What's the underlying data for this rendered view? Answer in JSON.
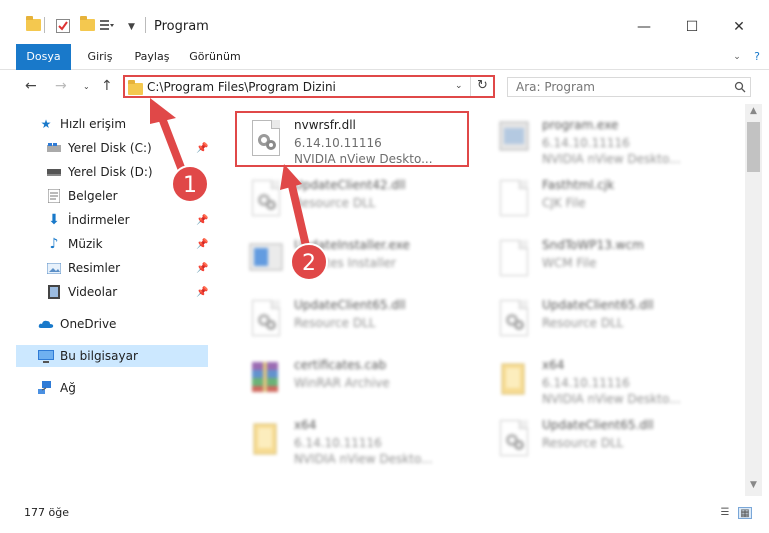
{
  "window": {
    "title": "Program",
    "minimize": "—",
    "maximize": "☐",
    "close": "✕"
  },
  "ribbon": {
    "tabs": [
      {
        "label": "Dosya"
      },
      {
        "label": "Giriş"
      },
      {
        "label": "Paylaş"
      },
      {
        "label": "Görünüm"
      }
    ]
  },
  "nav": {
    "address": "C:\\Program Files\\Program Dizini",
    "search_placeholder": "Ara: Program"
  },
  "sidebar": {
    "items": [
      {
        "label": "Hızlı erişim",
        "icon": "star-icon",
        "pinned": false
      },
      {
        "label": "Yerel Disk (C:)",
        "icon": "drive-icon",
        "pinned": true
      },
      {
        "label": "Yerel Disk (D:)",
        "icon": "drive-icon",
        "pinned": false
      },
      {
        "label": "Belgeler",
        "icon": "documents-icon",
        "pinned": false
      },
      {
        "label": "İndirmeler",
        "icon": "downloads-icon",
        "pinned": true
      },
      {
        "label": "Müzik",
        "icon": "music-icon",
        "pinned": true
      },
      {
        "label": "Resimler",
        "icon": "pictures-icon",
        "pinned": true
      },
      {
        "label": "Videolar",
        "icon": "videos-icon",
        "pinned": true
      },
      {
        "label": "OneDrive",
        "icon": "cloud-icon",
        "pinned": false
      },
      {
        "label": "Bu bilgisayar",
        "icon": "computer-icon",
        "pinned": false
      },
      {
        "label": "Ağ",
        "icon": "network-icon",
        "pinned": false
      }
    ]
  },
  "files": [
    {
      "name": "nvwrsfr.dll",
      "line1": "6.14.10.11116",
      "line2": "NVIDIA nView Deskto...",
      "blurred": false,
      "kind": "dll"
    },
    {
      "name": "program.exe",
      "line1": "6.14.10.11116",
      "line2": "NVIDIA nView Deskto...",
      "blurred": true,
      "kind": "exe"
    },
    {
      "name": "UpdateClient42.dll",
      "line1": "Resource DLL",
      "line2": "",
      "blurred": true,
      "kind": "dll"
    },
    {
      "name": "Fasthtml.cjk",
      "line1": "CJK File",
      "line2": "",
      "blurred": true,
      "kind": "doc"
    },
    {
      "name": "UpdateInstaller.exe",
      "line1": "Updates Installer",
      "line2": "",
      "blurred": true,
      "kind": "exe"
    },
    {
      "name": "SndToWP13.wcm",
      "line1": "WCM File",
      "line2": "",
      "blurred": true,
      "kind": "doc"
    },
    {
      "name": "UpdateClient65.dll",
      "line1": "Resource DLL",
      "line2": "",
      "blurred": true,
      "kind": "dll"
    },
    {
      "name": "UpdateClient65.dll",
      "line1": "Resource DLL",
      "line2": "",
      "blurred": true,
      "kind": "dll"
    },
    {
      "name": "certificates.cab",
      "line1": "WinRAR Archive",
      "line2": "",
      "blurred": true,
      "kind": "archive"
    },
    {
      "name": "x64",
      "line1": "6.14.10.11116",
      "line2": "NVIDIA nView Deskto...",
      "blurred": true,
      "kind": "folder"
    },
    {
      "name": "x64",
      "line1": "6.14.10.11116",
      "line2": "NVIDIA nView Deskto...",
      "blurred": true,
      "kind": "folder"
    },
    {
      "name": "UpdateClient65.dll",
      "line1": "Resource DLL",
      "line2": "",
      "blurred": true,
      "kind": "dll"
    }
  ],
  "status": {
    "count": "177 öğe"
  },
  "annotations": {
    "badge1": "1",
    "badge2": "2",
    "accent": "#e04848"
  },
  "colors": {
    "file_tab": "#1979ca",
    "selection": "#cce8ff"
  }
}
